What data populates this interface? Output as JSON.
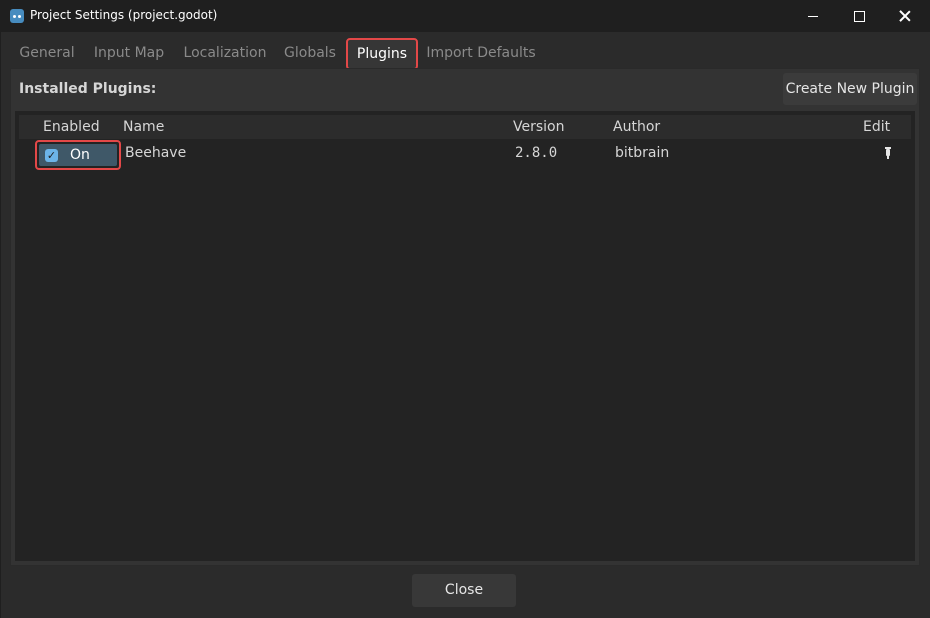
{
  "window": {
    "title": "Project Settings (project.godot)",
    "icon": "godot-icon",
    "controls": [
      "minimize-icon",
      "maximize-icon",
      "close-icon"
    ]
  },
  "tabs": [
    {
      "label": "General",
      "active": false
    },
    {
      "label": "Input Map",
      "active": false
    },
    {
      "label": "Localization",
      "active": false
    },
    {
      "label": "Globals",
      "active": false
    },
    {
      "label": "Plugins",
      "active": true
    },
    {
      "label": "Import Defaults",
      "active": false
    }
  ],
  "plugins_panel": {
    "installed_label": "Installed Plugins:",
    "create_button": "Create New Plugin",
    "columns": [
      "Enabled",
      "Name",
      "Version",
      "Author",
      "Edit"
    ],
    "rows": [
      {
        "enabled": true,
        "enabled_label": "On",
        "name": "Beehave",
        "version": "2.8.0",
        "author": "bitbrain",
        "edit_icon": "edit-pen-icon"
      }
    ]
  },
  "footer": {
    "close_button": "Close"
  },
  "colors": {
    "accent": "#478cbf",
    "highlight_border": "#e34848",
    "checkbox": "#6cb4e8"
  }
}
